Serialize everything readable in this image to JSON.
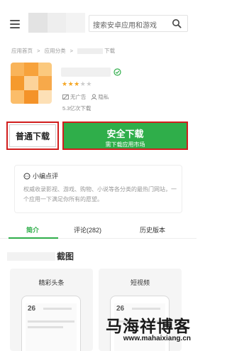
{
  "header": {
    "search_placeholder": "搜索安卓应用和游戏"
  },
  "breadcrumb": {
    "items": [
      "应用首页",
      "应用分类"
    ],
    "separator": ">",
    "current_suffix": "下载"
  },
  "app": {
    "rating_stars": 3,
    "rating_max": 5,
    "tags": [
      "无广告",
      "隐私"
    ],
    "downloads": "5.3亿次下载"
  },
  "buttons": {
    "normal_download": "普通下载",
    "safe_download": "安全下载",
    "safe_download_sub": "需下载应用市场"
  },
  "review": {
    "title": "小编点评",
    "text": "权威收录影视、游戏、购物、小说等各分类的最热门网站，一个应用一下满足你所有的愿望。"
  },
  "tabs": [
    {
      "label": "简介",
      "active": true
    },
    {
      "label": "评论(282)",
      "active": false
    },
    {
      "label": "历史版本",
      "active": false
    }
  ],
  "screenshots": {
    "title_suffix": "截图",
    "items": [
      {
        "label": "精彩头条",
        "day": "26"
      },
      {
        "label": "短视频",
        "day": "26"
      }
    ]
  },
  "watermark": {
    "title": "马海祥博客",
    "url": "www.mahaixiang.cn"
  },
  "colors": {
    "accent_green": "#2fae4a",
    "highlight_red": "#d11d1d",
    "star": "#f5a623",
    "icon_orange": "#f7a23b"
  }
}
